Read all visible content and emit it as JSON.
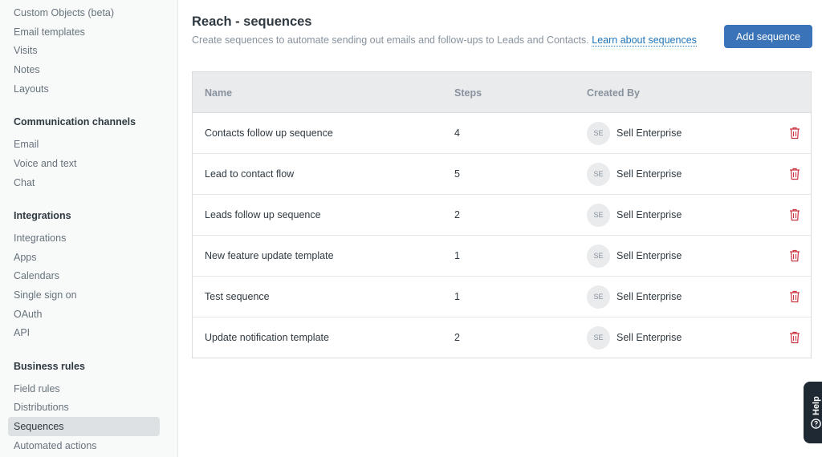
{
  "sidebar": {
    "top_items": [
      {
        "label": "Custom Objects (beta)"
      },
      {
        "label": "Email templates"
      },
      {
        "label": "Visits"
      },
      {
        "label": "Notes"
      },
      {
        "label": "Layouts"
      }
    ],
    "sections": [
      {
        "heading": "Communication channels",
        "items": [
          {
            "label": "Email"
          },
          {
            "label": "Voice and text"
          },
          {
            "label": "Chat"
          }
        ]
      },
      {
        "heading": "Integrations",
        "items": [
          {
            "label": "Integrations"
          },
          {
            "label": "Apps"
          },
          {
            "label": "Calendars"
          },
          {
            "label": "Single sign on"
          },
          {
            "label": "OAuth"
          },
          {
            "label": "API"
          }
        ]
      },
      {
        "heading": "Business rules",
        "items": [
          {
            "label": "Field rules"
          },
          {
            "label": "Distributions"
          },
          {
            "label": "Sequences",
            "active": true
          },
          {
            "label": "Automated actions"
          }
        ]
      }
    ]
  },
  "header": {
    "title": "Reach - sequences",
    "subtitle": "Create sequences to automate sending out emails and follow-ups to Leads and Contacts.",
    "learn_link": "Learn about sequences",
    "add_button": "Add sequence"
  },
  "table": {
    "columns": {
      "name": "Name",
      "steps": "Steps",
      "created_by": "Created By"
    },
    "rows": [
      {
        "name": "Contacts follow up sequence",
        "steps": "4",
        "initials": "SE",
        "creator": "Sell Enterprise"
      },
      {
        "name": "Lead to contact flow",
        "steps": "5",
        "initials": "SE",
        "creator": "Sell Enterprise"
      },
      {
        "name": "Leads follow up sequence",
        "steps": "2",
        "initials": "SE",
        "creator": "Sell Enterprise"
      },
      {
        "name": "New feature update template",
        "steps": "1",
        "initials": "SE",
        "creator": "Sell Enterprise"
      },
      {
        "name": "Test sequence",
        "steps": "1",
        "initials": "SE",
        "creator": "Sell Enterprise"
      },
      {
        "name": "Update notification template",
        "steps": "2",
        "initials": "SE",
        "creator": "Sell Enterprise"
      }
    ]
  },
  "help": {
    "label": "Help"
  },
  "colors": {
    "accent": "#3b73b9",
    "delete": "#cc3340",
    "help_bg": "#1f2933"
  }
}
